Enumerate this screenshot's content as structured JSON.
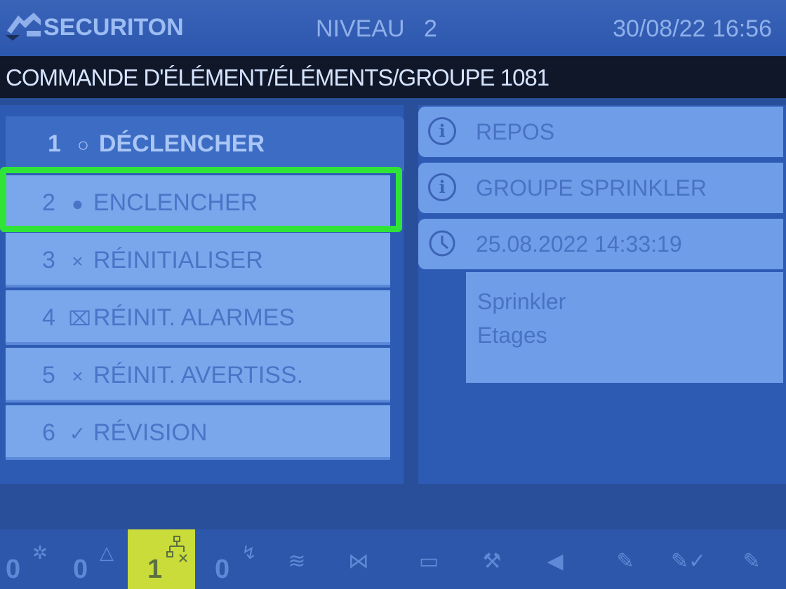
{
  "header": {
    "brand": "SECURITON",
    "level": "NIVEAU 2",
    "datetime": "30/08/22 16:56"
  },
  "path": "COMMANDE D'ÉLÉMENT/ÉLÉMENTS/GROUPE 1081",
  "menu": {
    "items": [
      {
        "num": "1",
        "glyph": "○",
        "label": "DÉCLENCHER"
      },
      {
        "num": "2",
        "glyph": "●",
        "label": "ENCLENCHER"
      },
      {
        "num": "3",
        "glyph": "×",
        "label": "RÉINITIALISER"
      },
      {
        "num": "4",
        "glyph": "⌧",
        "label": "RÉINIT. ALARMES"
      },
      {
        "num": "5",
        "glyph": "×",
        "label": "RÉINIT. AVERTISS."
      },
      {
        "num": "6",
        "glyph": "✓",
        "label": "RÉVISION"
      }
    ],
    "selected_index": 1
  },
  "info": {
    "state": {
      "icon": "info-icon",
      "text": "REPOS"
    },
    "type": {
      "icon": "info-icon",
      "text": "GROUPE SPRINKLER"
    },
    "timestamp": {
      "icon": "clock-icon",
      "text": "25.08.2022 14:33:19"
    },
    "description_line1": "Sprinkler",
    "description_line2": "Etages"
  },
  "statusbar": {
    "alarm": {
      "count": "0",
      "icon": "alarm-icon"
    },
    "warning": {
      "count": "0",
      "icon": "warning-icon"
    },
    "disabled": {
      "count": "1",
      "icon": "network-disabled-icon"
    },
    "fault": {
      "count": "0",
      "icon": "fault-icon"
    },
    "icons": [
      "sprinkler-icon",
      "detector-off-icon",
      "printer-icon",
      "tool-icon",
      "horn-icon",
      "edit-icon",
      "edit-check-icon",
      "edit-other-icon"
    ]
  },
  "colors": {
    "background": "#2a4f9a",
    "menu_item": "#7aa7ec",
    "selection_highlight": "#2fe437",
    "active_status": "#c9dc3a"
  }
}
